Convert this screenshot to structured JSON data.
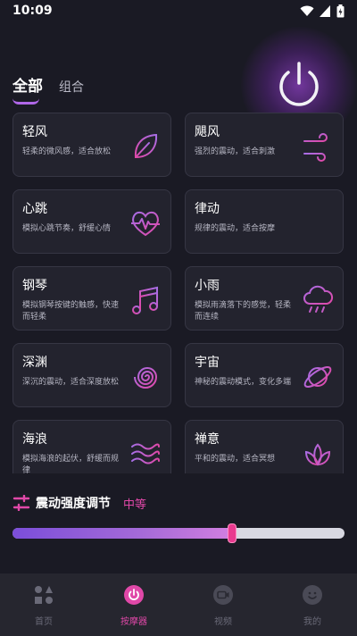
{
  "status": {
    "time": "10:09"
  },
  "tabs": [
    {
      "label": "全部",
      "active": true
    },
    {
      "label": "组合",
      "active": false
    }
  ],
  "modes": [
    {
      "title": "轻风",
      "desc": "轻柔的微风感，适合放松",
      "icon": "leaf-icon"
    },
    {
      "title": "飓风",
      "desc": "强烈的震动，适合刺激",
      "icon": "wind-icon"
    },
    {
      "title": "心跳",
      "desc": "模拟心跳节奏，舒缓心情",
      "icon": "heartbeat-icon"
    },
    {
      "title": "律动",
      "desc": "规律的震动，适合按摩",
      "icon": "soundwave-icon"
    },
    {
      "title": "钢琴",
      "desc": "模拟钢琴按键的触感，快速而轻柔",
      "icon": "music-note-icon"
    },
    {
      "title": "小雨",
      "desc": "模拟雨滴落下的感觉，轻柔而连续",
      "icon": "rain-cloud-icon"
    },
    {
      "title": "深渊",
      "desc": "深沉的震动，适合深度放松",
      "icon": "spiral-icon"
    },
    {
      "title": "宇宙",
      "desc": "神秘的震动模式，变化多端",
      "icon": "planet-icon"
    },
    {
      "title": "海浪",
      "desc": "模拟海浪的起伏，舒缓而规律",
      "icon": "waves-icon"
    },
    {
      "title": "禅意",
      "desc": "平和的震动，适合冥想",
      "icon": "lotus-icon"
    }
  ],
  "intensity": {
    "label": "震动强度调节",
    "level": "中等",
    "value_fraction": 0.66
  },
  "nav": [
    {
      "label": "首页",
      "icon": "shapes-icon",
      "active": false
    },
    {
      "label": "按摩器",
      "icon": "power-icon",
      "active": true
    },
    {
      "label": "视频",
      "icon": "video-icon",
      "active": false
    },
    {
      "label": "我的",
      "icon": "smiley-icon",
      "active": false
    }
  ],
  "colors": {
    "accent": "#e048a8",
    "purple": "#a86ee6",
    "background": "#1a1a24"
  }
}
